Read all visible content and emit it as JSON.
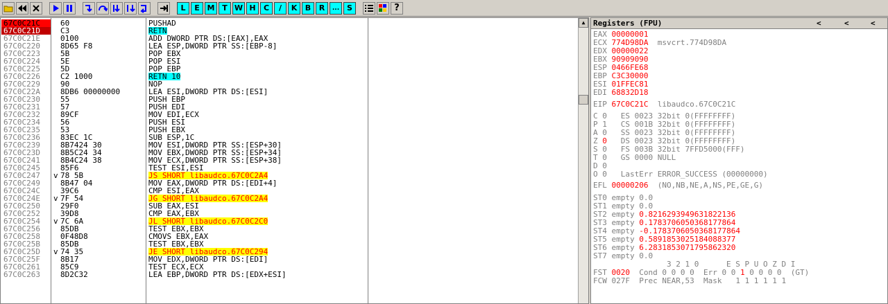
{
  "toolbar": {
    "buttons": [
      "open-icon",
      "rewind-icon",
      "close-icon",
      "run-icon",
      "pause-icon",
      "step-into-icon",
      "step-over-icon",
      "trace-into-icon",
      "trace-over-icon",
      "execute-till-return-icon",
      "go-to-icon"
    ],
    "letters": [
      "L",
      "E",
      "M",
      "T",
      "W",
      "H",
      "C",
      "/",
      "K",
      "B",
      "R",
      "...",
      "S"
    ],
    "right_buttons": [
      "list-icon",
      "grid-icon",
      "help-icon"
    ]
  },
  "disasm": {
    "rows": [
      {
        "addr": "67C0C21C",
        "mark": "",
        "hex": "60",
        "asm": "PUSHAD",
        "style": "cur",
        "asm_style": ""
      },
      {
        "addr": "67C0C21D",
        "mark": "",
        "hex": "C3",
        "asm": "RETN",
        "style": "red",
        "asm_style": "retn"
      },
      {
        "addr": "67C0C21E",
        "mark": "",
        "hex": "0100",
        "asm": "ADD DWORD PTR DS:[EAX],EAX",
        "style": "",
        "asm_style": ""
      },
      {
        "addr": "67C0C220",
        "mark": "",
        "hex": "8D65 F8",
        "asm": "LEA ESP,DWORD PTR SS:[EBP-8]",
        "style": "",
        "asm_style": ""
      },
      {
        "addr": "67C0C223",
        "mark": "",
        "hex": "5B",
        "asm": "POP EBX",
        "style": "",
        "asm_style": ""
      },
      {
        "addr": "67C0C224",
        "mark": "",
        "hex": "5E",
        "asm": "POP ESI",
        "style": "",
        "asm_style": ""
      },
      {
        "addr": "67C0C225",
        "mark": "",
        "hex": "5D",
        "asm": "POP EBP",
        "style": "",
        "asm_style": ""
      },
      {
        "addr": "67C0C226",
        "mark": "",
        "hex": "C2 1000",
        "asm": "RETN 10",
        "style": "",
        "asm_style": "retn"
      },
      {
        "addr": "67C0C229",
        "mark": "",
        "hex": "90",
        "asm": "NOP",
        "style": "",
        "asm_style": ""
      },
      {
        "addr": "67C0C22A",
        "mark": "",
        "hex": "8DB6 00000000",
        "asm": "LEA ESI,DWORD PTR DS:[ESI]",
        "style": "",
        "asm_style": ""
      },
      {
        "addr": "67C0C230",
        "mark": "",
        "hex": "55",
        "asm": "PUSH EBP",
        "style": "",
        "asm_style": ""
      },
      {
        "addr": "67C0C231",
        "mark": "",
        "hex": "57",
        "asm": "PUSH EDI",
        "style": "",
        "asm_style": ""
      },
      {
        "addr": "67C0C232",
        "mark": "",
        "hex": "89CF",
        "asm": "MOV EDI,ECX",
        "style": "",
        "asm_style": ""
      },
      {
        "addr": "67C0C234",
        "mark": "",
        "hex": "56",
        "asm": "PUSH ESI",
        "style": "",
        "asm_style": ""
      },
      {
        "addr": "67C0C235",
        "mark": "",
        "hex": "53",
        "asm": "PUSH EBX",
        "style": "",
        "asm_style": ""
      },
      {
        "addr": "67C0C236",
        "mark": "",
        "hex": "83EC 1C",
        "asm": "SUB ESP,1C",
        "style": "",
        "asm_style": ""
      },
      {
        "addr": "67C0C239",
        "mark": "",
        "hex": "8B7424 30",
        "asm": "MOV ESI,DWORD PTR SS:[ESP+30]",
        "style": "",
        "asm_style": ""
      },
      {
        "addr": "67C0C23D",
        "mark": "",
        "hex": "8B5C24 34",
        "asm": "MOV EBX,DWORD PTR SS:[ESP+34]",
        "style": "",
        "asm_style": ""
      },
      {
        "addr": "67C0C241",
        "mark": "",
        "hex": "8B4C24 38",
        "asm": "MOV ECX,DWORD PTR SS:[ESP+38]",
        "style": "",
        "asm_style": ""
      },
      {
        "addr": "67C0C245",
        "mark": "",
        "hex": "85F6",
        "asm": "TEST ESI,ESI",
        "style": "",
        "asm_style": ""
      },
      {
        "addr": "67C0C247",
        "mark": "v",
        "hex": "78 5B",
        "asm": "JS SHORT libaudco.67C0C2A4",
        "style": "",
        "asm_style": "jmp"
      },
      {
        "addr": "67C0C249",
        "mark": "",
        "hex": "8B47 04",
        "asm": "MOV EAX,DWORD PTR DS:[EDI+4]",
        "style": "",
        "asm_style": ""
      },
      {
        "addr": "67C0C24C",
        "mark": "",
        "hex": "39C6",
        "asm": "CMP ESI,EAX",
        "style": "",
        "asm_style": ""
      },
      {
        "addr": "67C0C24E",
        "mark": "v",
        "hex": "7F 54",
        "asm": "JG SHORT libaudco.67C0C2A4",
        "style": "",
        "asm_style": "jmp"
      },
      {
        "addr": "67C0C250",
        "mark": "",
        "hex": "29F0",
        "asm": "SUB EAX,ESI",
        "style": "",
        "asm_style": ""
      },
      {
        "addr": "67C0C252",
        "mark": "",
        "hex": "39D8",
        "asm": "CMP EAX,EBX",
        "style": "",
        "asm_style": ""
      },
      {
        "addr": "67C0C254",
        "mark": "v",
        "hex": "7C 6A",
        "asm": "JL SHORT libaudco.67C0C2C0",
        "style": "",
        "asm_style": "jmp"
      },
      {
        "addr": "67C0C256",
        "mark": "",
        "hex": "85DB",
        "asm": "TEST EBX,EBX",
        "style": "",
        "asm_style": ""
      },
      {
        "addr": "67C0C258",
        "mark": "",
        "hex": "0F48D8",
        "asm": "CMOVS EBX,EAX",
        "style": "",
        "asm_style": ""
      },
      {
        "addr": "67C0C25B",
        "mark": "",
        "hex": "85DB",
        "asm": "TEST EBX,EBX",
        "style": "",
        "asm_style": ""
      },
      {
        "addr": "67C0C25D",
        "mark": "v",
        "hex": "74 35",
        "asm": "JE SHORT libaudco.67C0C294",
        "style": "",
        "asm_style": "jmp"
      },
      {
        "addr": "67C0C25F",
        "mark": "",
        "hex": "8B17",
        "asm": "MOV EDX,DWORD PTR DS:[EDI]",
        "style": "",
        "asm_style": ""
      },
      {
        "addr": "67C0C261",
        "mark": "",
        "hex": "85C9",
        "asm": "TEST ECX,ECX",
        "style": "",
        "asm_style": ""
      },
      {
        "addr": "67C0C263",
        "mark": "",
        "hex": "8D2C32",
        "asm": "LEA EBP,DWORD PTR DS:[EDX+ESI]",
        "style": "",
        "asm_style": ""
      }
    ]
  },
  "registers": {
    "title": "Registers (FPU)",
    "arrows": [
      "<",
      "<",
      "<"
    ],
    "gpr": [
      {
        "name": "EAX",
        "value": "00000001",
        "comment": ""
      },
      {
        "name": "ECX",
        "value": "774D98DA",
        "comment": "msvcrt.774D98DA"
      },
      {
        "name": "EDX",
        "value": "00000022",
        "comment": ""
      },
      {
        "name": "EBX",
        "value": "90909090",
        "comment": ""
      },
      {
        "name": "ESP",
        "value": "0466FE68",
        "comment": ""
      },
      {
        "name": "EBP",
        "value": "C3C30000",
        "comment": ""
      },
      {
        "name": "ESI",
        "value": "01FFEC81",
        "comment": ""
      },
      {
        "name": "EDI",
        "value": "68832D18",
        "comment": ""
      }
    ],
    "eip": {
      "name": "EIP",
      "value": "67C0C21C",
      "comment": "libaudco.67C0C21C"
    },
    "flags": [
      {
        "flag": "C",
        "fv": "0",
        "seg": "ES",
        "sv": "0023",
        "bits": "32bit",
        "base": "0(FFFFFFFF)",
        "red": false
      },
      {
        "flag": "P",
        "fv": "1",
        "seg": "CS",
        "sv": "001B",
        "bits": "32bit",
        "base": "0(FFFFFFFF)",
        "red": false
      },
      {
        "flag": "A",
        "fv": "0",
        "seg": "SS",
        "sv": "0023",
        "bits": "32bit",
        "base": "0(FFFFFFFF)",
        "red": false
      },
      {
        "flag": "Z",
        "fv": "0",
        "seg": "DS",
        "sv": "0023",
        "bits": "32bit",
        "base": "0(FFFFFFFF)",
        "red": true
      },
      {
        "flag": "S",
        "fv": "0",
        "seg": "FS",
        "sv": "003B",
        "bits": "32bit",
        "base": "7FFD5000(FFF)",
        "red": false
      },
      {
        "flag": "T",
        "fv": "0",
        "seg": "GS",
        "sv": "0000",
        "bits": "NULL",
        "base": "",
        "red": false
      },
      {
        "flag": "D",
        "fv": "0",
        "seg": "",
        "sv": "",
        "bits": "",
        "base": "",
        "red": false
      },
      {
        "flag": "O",
        "fv": "0",
        "seg": "LastErr",
        "sv": "ERROR_SUCCESS",
        "bits": "(00000000)",
        "base": "",
        "red": false
      }
    ],
    "efl": {
      "name": "EFL",
      "value": "00000206",
      "comment": "(NO,NB,NE,A,NS,PE,GE,G)"
    },
    "st": [
      {
        "name": "ST0",
        "tag": "empty",
        "value": "0.0",
        "red": false
      },
      {
        "name": "ST1",
        "tag": "empty",
        "value": "0.0",
        "red": false
      },
      {
        "name": "ST2",
        "tag": "empty",
        "value": "0.8216293949631822136",
        "red": true
      },
      {
        "name": "ST3",
        "tag": "empty",
        "value": "0.1783706050368177864",
        "red": true
      },
      {
        "name": "ST4",
        "tag": "empty",
        "value": "-0.1783706050368177864",
        "red": true
      },
      {
        "name": "ST5",
        "tag": "empty",
        "value": "0.5891853025184088377",
        "red": true
      },
      {
        "name": "ST6",
        "tag": "empty",
        "value": "6.2831853071795862320",
        "red": true
      },
      {
        "name": "ST7",
        "tag": "empty",
        "value": "0.0",
        "red": false
      }
    ],
    "fpu_bits_header": "3 2 1 0      E S P U O Z D I",
    "fst": {
      "label": "FST",
      "value": "0020",
      "cond_label": "Cond",
      "cond": "0 0 0 0",
      "err_label": "Err",
      "err_pre": "0 0 ",
      "err_red": "1",
      "err_post": " 0 0 0 0",
      "gt": "(GT)"
    },
    "fcw": {
      "label": "FCW",
      "value": "027F",
      "prec_label": "Prec",
      "prec": "NEAR,53",
      "mask_label": "Mask",
      "mask": "1 1 1 1 1 1"
    }
  }
}
